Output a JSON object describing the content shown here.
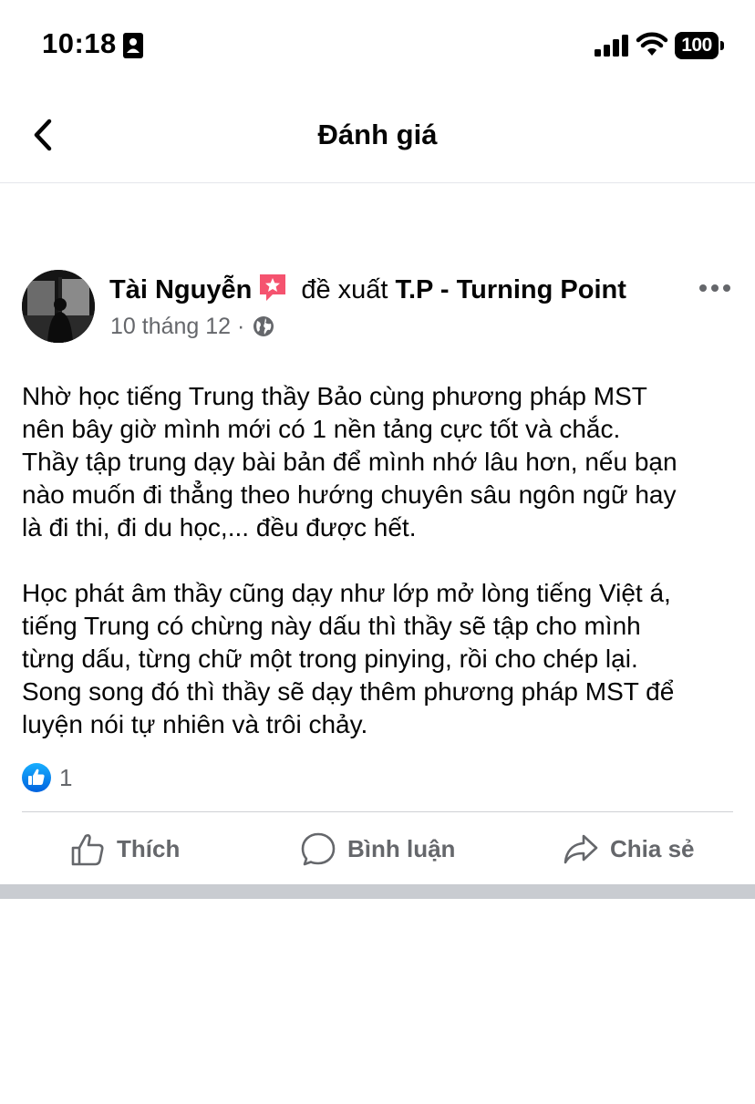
{
  "status_bar": {
    "time": "10:18",
    "battery": "100",
    "icons": [
      "id-card-icon",
      "signal-icon",
      "wifi-icon",
      "battery-icon"
    ]
  },
  "header": {
    "title": "Đánh giá",
    "back_icon": "chevron-left-icon"
  },
  "post": {
    "author": "Tài Nguyễn",
    "badge_icon": "star-badge-icon",
    "recommend_text": "đề xuất",
    "page_name": "T.P - Turning Point",
    "date": "10 tháng 12",
    "separator": "·",
    "privacy_icon": "globe-icon",
    "more_icon": "more-horizontal-icon",
    "body": [
      "Nhờ học tiếng Trung thầy Bảo cùng phương pháp MST\nnên bây giờ mình mới có 1 nền tảng cực tốt và chắc.\nThầy tập trung dạy bài bản để mình nhớ lâu hơn, nếu bạn\nnào muốn đi thẳng theo hướng chuyên sâu ngôn ngữ hay\nlà đi thi, đi du học,... đều được hết.",
      "Học phát âm thầy cũng dạy như lớp mở lòng tiếng Việt á,\ntiếng Trung có chừng này dấu thì thầy sẽ tập cho mình\ntừng dấu, từng chữ một trong pinying, rồi cho chép lại.\nSong song đó thì thầy sẽ dạy thêm phương pháp MST để\nluyện nói tự nhiên và trôi chảy."
    ],
    "reaction_count": "1"
  },
  "actions": {
    "like": "Thích",
    "comment": "Bình luận",
    "share": "Chia sẻ"
  },
  "colors": {
    "text": "#050505",
    "secondary": "#65676b",
    "facebook_blue": "#1877f2",
    "badge_pink": "#f5536f",
    "separator": "#c9ccd1"
  }
}
